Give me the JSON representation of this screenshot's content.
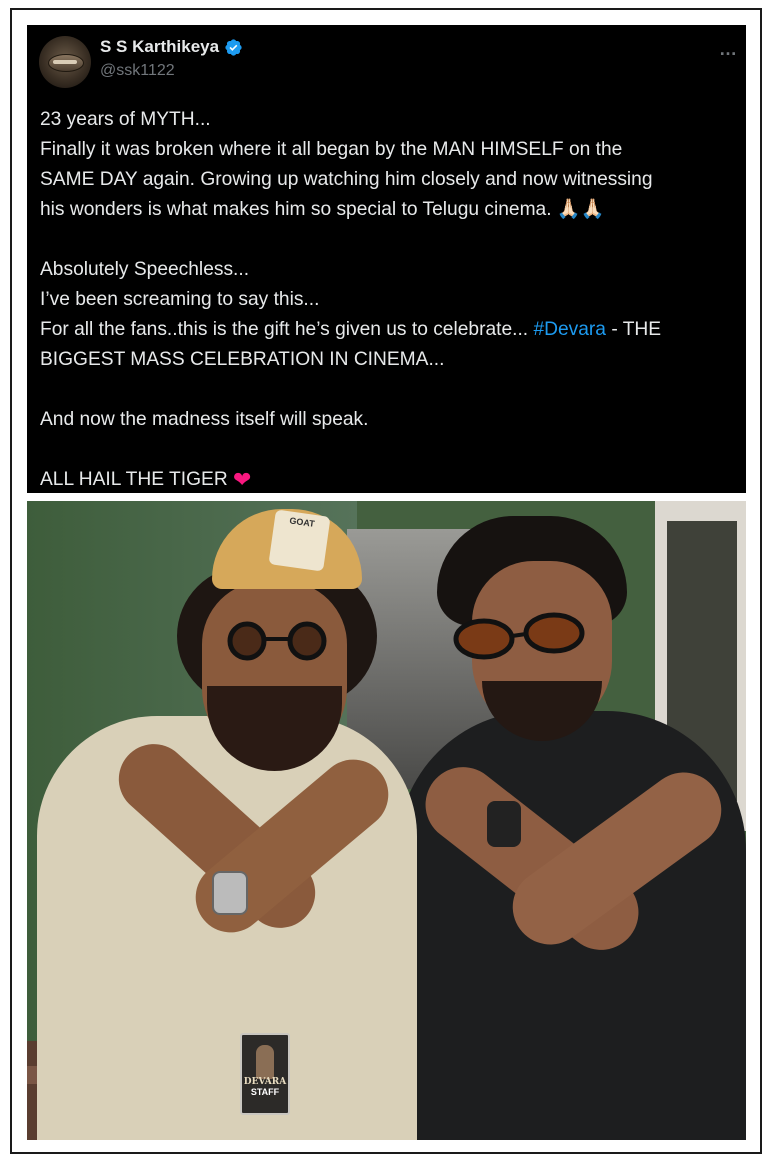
{
  "tweet": {
    "author_name": "S S Karthikeya",
    "author_handle": "@ssk1122",
    "verified_color": "#1d9bf0",
    "more_icon": "…",
    "paragraphs": [
      [
        "23 years of MYTH...",
        "Finally it was broken where it all began by the MAN HIMSELF on the",
        "SAME DAY again. Growing up watching him closely and now witnessing",
        "his wonders is what makes him so special to Telugu cinema. 🙏🏻🙏🏻"
      ],
      [
        "Absolutely Speechless...",
        "I’ve been screaming to say this..."
      ],
      [
        "And now the madness itself will speak."
      ],
      [
        "ALL HAIL THE TIGER"
      ]
    ],
    "fans_line_before": "For all the fans..this is the gift he’s given us to celebrate... ",
    "hashtag": "#Devara",
    "fans_line_after": " - THE",
    "fans_line_2": "BIGGEST MASS CELEBRATION IN CINEMA...",
    "heart": "❤",
    "colors": {
      "background": "#000000",
      "text": "#e7e9ea",
      "secondary": "#71767b",
      "hashtag": "#1d9bf0",
      "heart": "#f91880"
    }
  },
  "photo": {
    "badge_title": "DEVARA",
    "badge_label": "STAFF",
    "cap_label": "GOAT"
  }
}
